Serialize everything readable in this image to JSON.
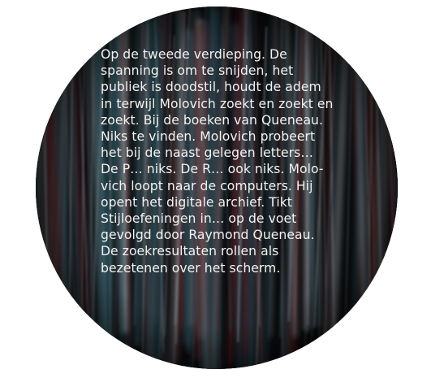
{
  "passage": {
    "text": "Op de tweede verdieping. De\nspanning is om te snijden, het\npubliek is doodstil, houdt de adem\nin terwijl Molovich zoekt en zoekt en\nzoekt. Bij de boeken van Queneau.\nNiks te vinden. Molovich probeert\nhet bij de naast gelegen letters…\nDe P… niks. De R… ook niks. Molo-\nvich loopt naar de computers. Hij\nopent het digitale archief. Tikt\nStijloefeningen in… op de voet\ngevolgd door Raymond Queneau.\nDe zoekresultaten rollen als\nbezetenen over het scherm."
  },
  "colors": {
    "background": "#0b0c0e",
    "streak_teal": "#2f5a66",
    "streak_red": "#6a1f24",
    "streak_grey": "#9aa3a8",
    "text": "#f2f2f2"
  }
}
